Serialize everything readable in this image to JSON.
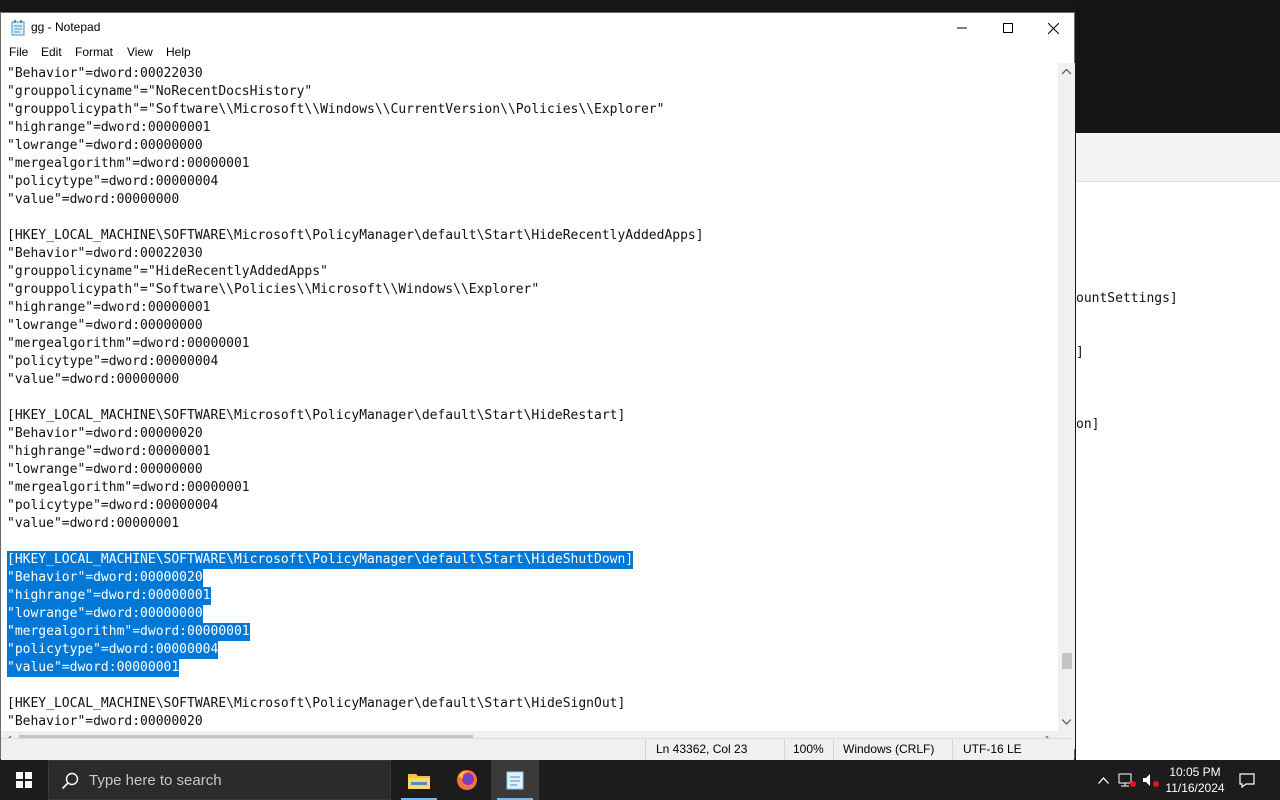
{
  "window": {
    "title": "gg - Notepad",
    "menu": [
      "File",
      "Edit",
      "Format",
      "View",
      "Help"
    ]
  },
  "editor_lines": [
    "\"Behavior\"=dword:00022030",
    "\"grouppolicyname\"=\"NoRecentDocsHistory\"",
    "\"grouppolicypath\"=\"Software\\\\Microsoft\\\\Windows\\\\CurrentVersion\\\\Policies\\\\Explorer\"",
    "\"highrange\"=dword:00000001",
    "\"lowrange\"=dword:00000000",
    "\"mergealgorithm\"=dword:00000001",
    "\"policytype\"=dword:00000004",
    "\"value\"=dword:00000000",
    "",
    "[HKEY_LOCAL_MACHINE\\SOFTWARE\\Microsoft\\PolicyManager\\default\\Start\\HideRecentlyAddedApps]",
    "\"Behavior\"=dword:00022030",
    "\"grouppolicyname\"=\"HideRecentlyAddedApps\"",
    "\"grouppolicypath\"=\"Software\\\\Policies\\\\Microsoft\\\\Windows\\\\Explorer\"",
    "\"highrange\"=dword:00000001",
    "\"lowrange\"=dword:00000000",
    "\"mergealgorithm\"=dword:00000001",
    "\"policytype\"=dword:00000004",
    "\"value\"=dword:00000000",
    "",
    "[HKEY_LOCAL_MACHINE\\SOFTWARE\\Microsoft\\PolicyManager\\default\\Start\\HideRestart]",
    "\"Behavior\"=dword:00000020",
    "\"highrange\"=dword:00000001",
    "\"lowrange\"=dword:00000000",
    "\"mergealgorithm\"=dword:00000001",
    "\"policytype\"=dword:00000004",
    "\"value\"=dword:00000001",
    "",
    "[HKEY_LOCAL_MACHINE\\SOFTWARE\\Microsoft\\PolicyManager\\default\\Start\\HideShutDown]",
    "\"Behavior\"=dword:00000020",
    "\"highrange\"=dword:00000001",
    "\"lowrange\"=dword:00000000",
    "\"mergealgorithm\"=dword:00000001",
    "\"policytype\"=dword:00000004",
    "\"value\"=dword:00000001",
    "",
    "[HKEY_LOCAL_MACHINE\\SOFTWARE\\Microsoft\\PolicyManager\\default\\Start\\HideSignOut]",
    "\"Behavior\"=dword:00000020"
  ],
  "selected_line_range": [
    27,
    33
  ],
  "status": {
    "position": "Ln 43362, Col 23",
    "zoom": "100%",
    "line_ending": "Windows (CRLF)",
    "encoding": "UTF-16 LE"
  },
  "background_window": {
    "fragments": [
      "ountSettings]",
      "]",
      "on]"
    ]
  },
  "taskbar": {
    "search_placeholder": "Type here to search",
    "time": "10:05 PM",
    "date": "11/16/2024"
  },
  "colors": {
    "selection": "#0078d7",
    "accent": "#7ab8ea"
  }
}
